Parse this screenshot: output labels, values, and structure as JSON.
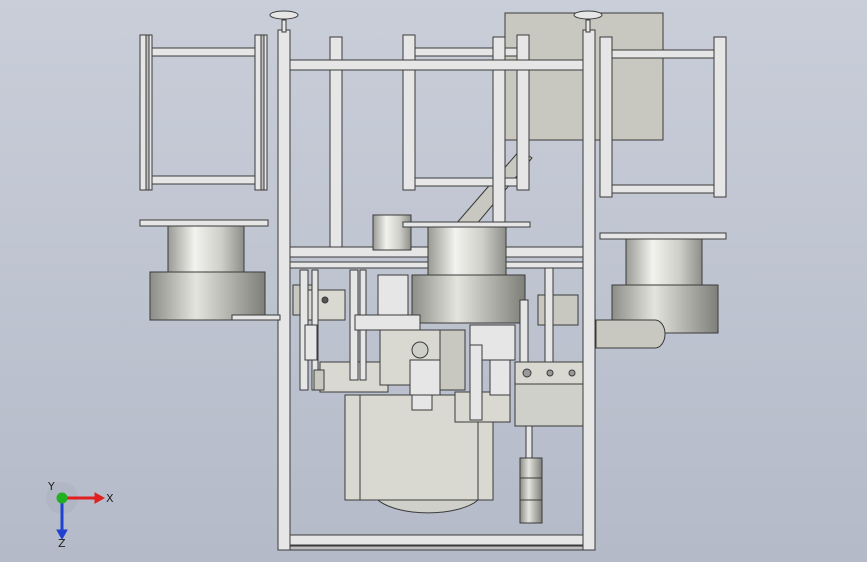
{
  "triad": {
    "x_label": "X",
    "y_label": "Y",
    "z_label": "Z",
    "x_color": "#e02020",
    "y_color": "#20b020",
    "z_color": "#2040d0"
  },
  "palette": {
    "background_top": "#c9ced9",
    "background_bottom": "#b4bac8",
    "frame": "#e6e6e6",
    "frame_edge": "#3a3a3a",
    "metal": "#d9d9d2",
    "panel": "#c8c8c0"
  }
}
